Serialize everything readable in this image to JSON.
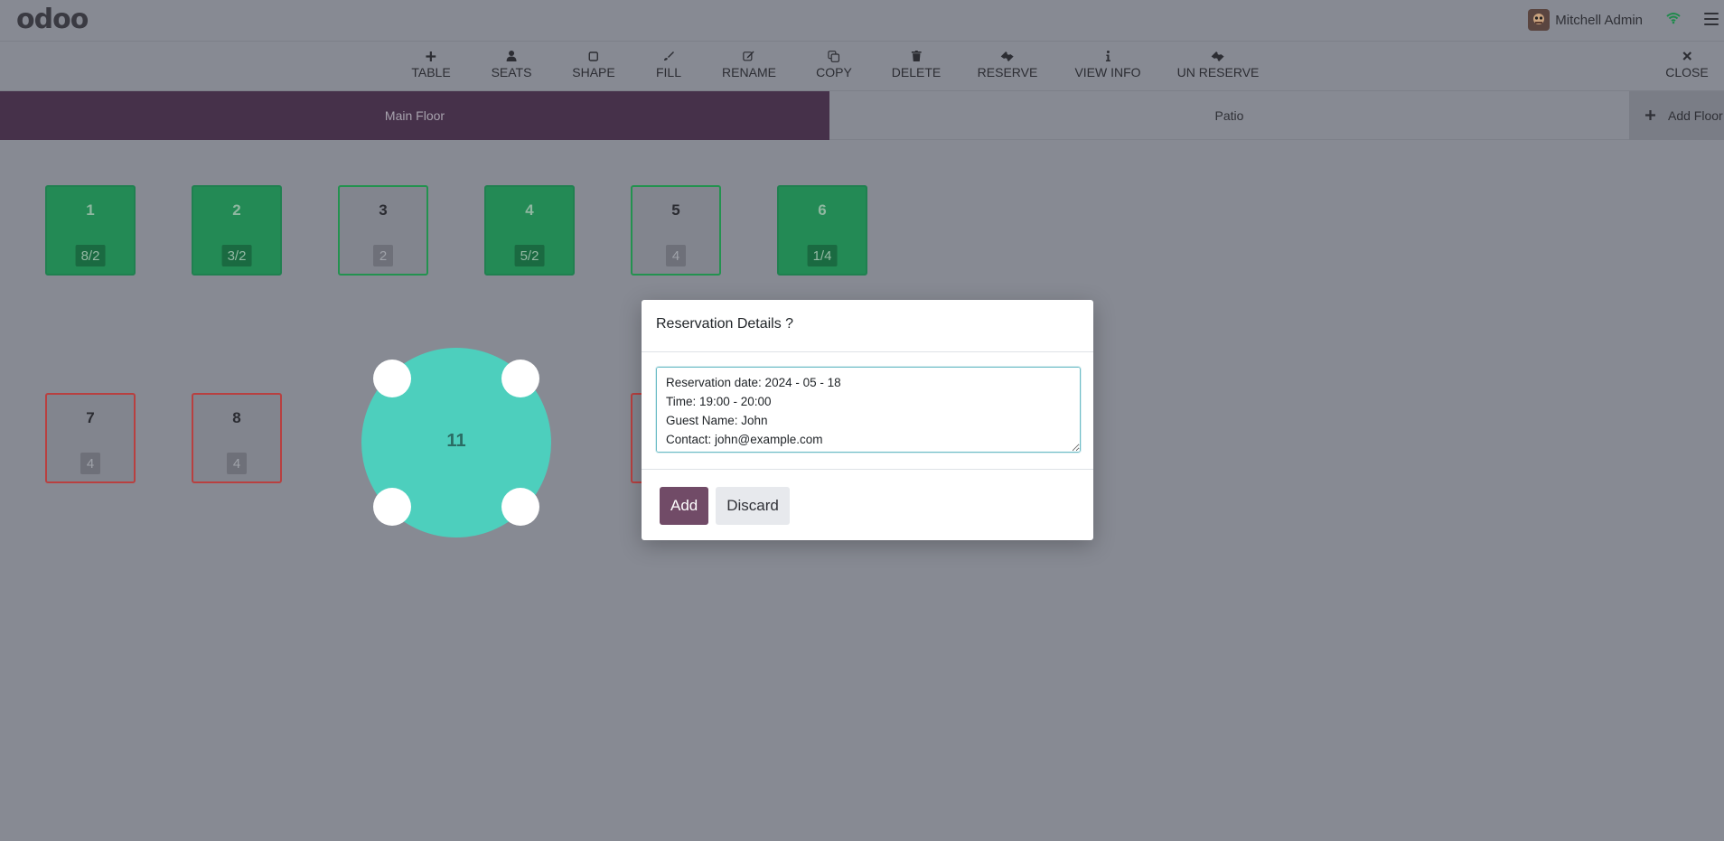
{
  "header": {
    "logo": "odoo",
    "user_name": "Mitchell Admin"
  },
  "toolbar": {
    "table": "TABLE",
    "seats": "SEATS",
    "shape": "SHAPE",
    "fill": "FILL",
    "rename": "RENAME",
    "copy": "COPY",
    "delete": "DELETE",
    "reserve": "RESERVE",
    "view_info": "VIEW INFO",
    "un_reserve": "UN RESERVE",
    "close": "CLOSE"
  },
  "floors": {
    "main": "Main Floor",
    "patio": "Patio",
    "add": "Add Floor"
  },
  "tables": [
    {
      "number": "1",
      "seats": "8/2"
    },
    {
      "number": "2",
      "seats": "3/2"
    },
    {
      "number": "3",
      "seats": "2"
    },
    {
      "number": "4",
      "seats": "5/2"
    },
    {
      "number": "5",
      "seats": "4"
    },
    {
      "number": "6",
      "seats": "1/4"
    },
    {
      "number": "7",
      "seats": "4"
    },
    {
      "number": "8",
      "seats": "4"
    },
    {
      "number": "11"
    }
  ],
  "modal": {
    "title": "Reservation Details ?",
    "textarea_value": "Reservation date: 2024 - 05 - 18\nTime: 19:00 - 20:00\nGuest Name: John\nContact: john@example.com",
    "add_label": "Add",
    "discard_label": "Discard"
  },
  "colors": {
    "brand": "#714b67",
    "occupied_table": "#238a55",
    "round_table": "#4dcfbd",
    "reserved_border": "#b84040"
  }
}
